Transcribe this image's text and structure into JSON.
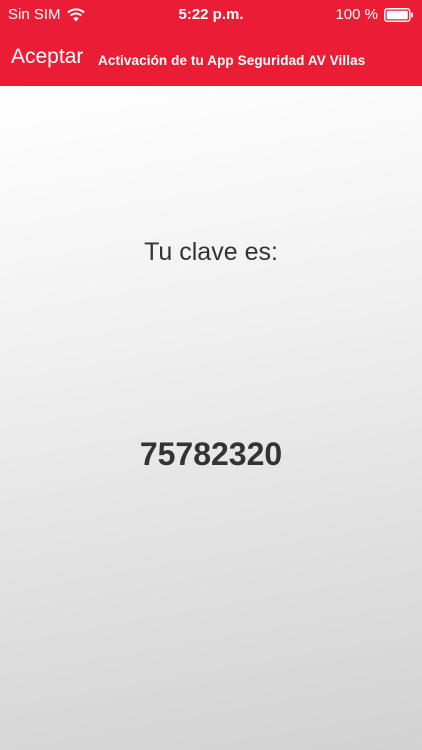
{
  "status_bar": {
    "carrier": "Sin SIM",
    "time": "5:22 p.m.",
    "battery": "100 %",
    "wifi_icon": "wifi-icon",
    "battery_icon": "battery-full-icon"
  },
  "nav": {
    "accept_label": "Aceptar",
    "title": "Activación de tu App Seguridad AV Villas"
  },
  "main": {
    "prompt": "Tu clave es:",
    "code": "75782320"
  },
  "colors": {
    "header_red": "#ea1d35",
    "text_dark": "#333333"
  }
}
